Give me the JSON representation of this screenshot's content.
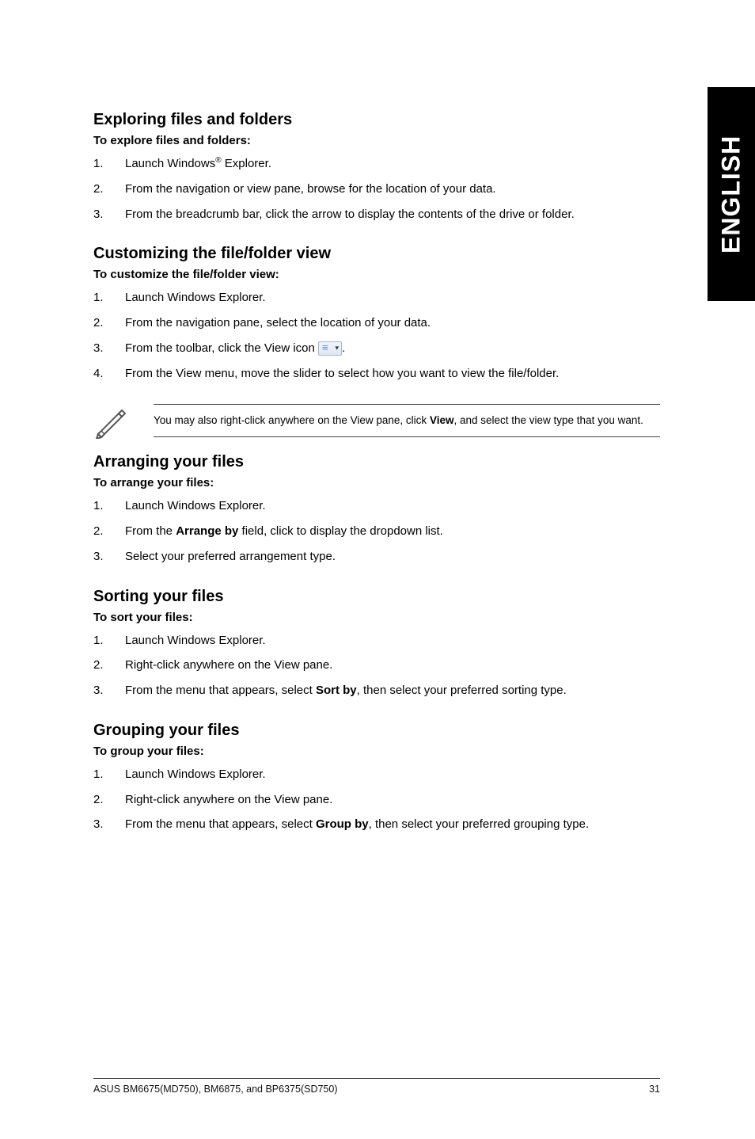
{
  "side_tab": "ENGLISH",
  "sections": {
    "exploring": {
      "title": "Exploring files and folders",
      "subhead": "To explore files and folders:",
      "steps": [
        {
          "num": "1.",
          "pre": "Launch Windows",
          "sup": "®",
          "post": " Explorer."
        },
        {
          "num": "2.",
          "text": "From the navigation or view pane, browse for the location of your data."
        },
        {
          "num": "3.",
          "text": "From the breadcrumb bar, click the arrow to display the contents of the drive or folder."
        }
      ]
    },
    "customizing": {
      "title": "Customizing the file/folder view",
      "subhead": "To customize the file/folder view:",
      "steps": [
        {
          "num": "1.",
          "text": "Launch Windows Explorer."
        },
        {
          "num": "2.",
          "text": "From the navigation pane, select the location of your data."
        },
        {
          "num": "3.",
          "pre": "From the toolbar, click the View icon ",
          "icon": true,
          "post": "."
        },
        {
          "num": "4.",
          "text": "From the View menu, move the slider to select how you want to view the file/folder."
        }
      ]
    },
    "note": {
      "pre": "You may also right-click anywhere on the View pane, click ",
      "bold": "View",
      "post": ", and select the view type that you want."
    },
    "arranging": {
      "title": "Arranging your files",
      "subhead": "To arrange your files:",
      "steps": [
        {
          "num": "1.",
          "text": "Launch Windows Explorer."
        },
        {
          "num": "2.",
          "pre": "From the ",
          "bold": "Arrange by",
          "post": " field, click to display the dropdown list."
        },
        {
          "num": "3.",
          "text": "Select your preferred arrangement type."
        }
      ]
    },
    "sorting": {
      "title": "Sorting your files",
      "subhead": "To sort your files:",
      "steps": [
        {
          "num": "1.",
          "text": "Launch Windows Explorer."
        },
        {
          "num": "2.",
          "text": "Right-click anywhere on the View pane."
        },
        {
          "num": "3.",
          "pre": "From the menu that appears, select ",
          "bold": "Sort by",
          "post": ", then select your preferred sorting type."
        }
      ]
    },
    "grouping": {
      "title": "Grouping your files",
      "subhead": "To group your files:",
      "steps": [
        {
          "num": "1.",
          "text": "Launch Windows Explorer."
        },
        {
          "num": "2.",
          "text": "Right-click anywhere on the View pane."
        },
        {
          "num": "3.",
          "pre": "From the menu that appears, select ",
          "bold": "Group by",
          "post": ", then select your preferred grouping type."
        }
      ]
    }
  },
  "footer": {
    "left": "ASUS BM6675(MD750), BM6875, and BP6375(SD750)",
    "right": "31"
  }
}
